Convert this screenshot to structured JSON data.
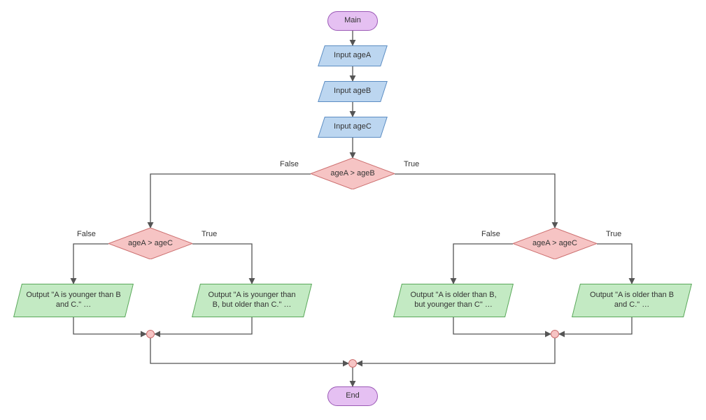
{
  "terminator": {
    "start": "Main",
    "end": "End"
  },
  "inputs": {
    "ageA": "Input ageA",
    "ageB": "Input ageB",
    "ageC": "Input ageC"
  },
  "decisions": {
    "root": "ageA > ageB",
    "leftChild": "ageA > ageC",
    "rightChild": "ageA > ageC"
  },
  "branchLabels": {
    "trueLabel": "True",
    "falseLabel": "False"
  },
  "outputs": {
    "leftFalse": "Output \"A is younger than B and C.\" …",
    "leftTrue": "Output \"A is younger than B, but older than C.\" …",
    "rightFalse": "Output \"A is older than B, but younger than C\" …",
    "rightTrue": "Output \"A is older than B and C.\" …"
  },
  "colors": {
    "terminatorFill": "#e5c0f2",
    "terminatorStroke": "#9b59b6",
    "ioFill": "#bcd6f0",
    "ioStroke": "#5b8cc2",
    "decisionFill": "#f6c4c4",
    "decisionStroke": "#cc6e6e",
    "outputFill": "#c3eac3",
    "outputStroke": "#5aa75a",
    "connector": "#555555"
  },
  "chart_data": {
    "type": "flowchart",
    "nodes": [
      {
        "id": "start",
        "type": "terminator",
        "label": "Main"
      },
      {
        "id": "inA",
        "type": "input",
        "label": "Input ageA"
      },
      {
        "id": "inB",
        "type": "input",
        "label": "Input ageB"
      },
      {
        "id": "inC",
        "type": "input",
        "label": "Input ageC"
      },
      {
        "id": "d1",
        "type": "decision",
        "label": "ageA > ageB"
      },
      {
        "id": "d2",
        "type": "decision",
        "label": "ageA > ageC"
      },
      {
        "id": "d3",
        "type": "decision",
        "label": "ageA > ageC"
      },
      {
        "id": "o1",
        "type": "output",
        "label": "Output \"A is younger than B and C.\" …"
      },
      {
        "id": "o2",
        "type": "output",
        "label": "Output \"A is younger than B, but older than C.\" …"
      },
      {
        "id": "o3",
        "type": "output",
        "label": "Output \"A is older than B, but younger than C\" …"
      },
      {
        "id": "o4",
        "type": "output",
        "label": "Output \"A is older than B and C.\" …"
      },
      {
        "id": "m1",
        "type": "merge"
      },
      {
        "id": "m2",
        "type": "merge"
      },
      {
        "id": "m3",
        "type": "merge"
      },
      {
        "id": "end",
        "type": "terminator",
        "label": "End"
      }
    ],
    "edges": [
      {
        "from": "start",
        "to": "inA"
      },
      {
        "from": "inA",
        "to": "inB"
      },
      {
        "from": "inB",
        "to": "inC"
      },
      {
        "from": "inC",
        "to": "d1"
      },
      {
        "from": "d1",
        "to": "d2",
        "label": "False"
      },
      {
        "from": "d1",
        "to": "d3",
        "label": "True"
      },
      {
        "from": "d2",
        "to": "o1",
        "label": "False"
      },
      {
        "from": "d2",
        "to": "o2",
        "label": "True"
      },
      {
        "from": "d3",
        "to": "o3",
        "label": "False"
      },
      {
        "from": "d3",
        "to": "o4",
        "label": "True"
      },
      {
        "from": "o1",
        "to": "m1"
      },
      {
        "from": "o2",
        "to": "m1"
      },
      {
        "from": "o3",
        "to": "m2"
      },
      {
        "from": "o4",
        "to": "m2"
      },
      {
        "from": "m1",
        "to": "m3"
      },
      {
        "from": "m2",
        "to": "m3"
      },
      {
        "from": "m3",
        "to": "end"
      }
    ]
  }
}
